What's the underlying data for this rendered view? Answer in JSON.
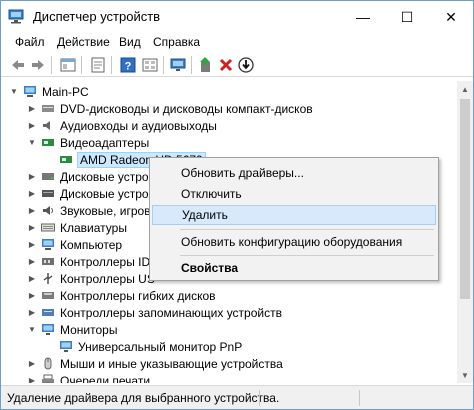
{
  "window": {
    "title": "Диспетчер устройств",
    "minimize_glyph": "—",
    "maximize_glyph": "☐",
    "close_glyph": "✕"
  },
  "menu": {
    "file": "Файл",
    "action": "Действие",
    "view": "Вид",
    "help": "Справка"
  },
  "toolbar": {
    "icons": [
      "back-arrow-icon",
      "forward-arrow-icon",
      "console-tree-icon",
      "properties-icon",
      "help-icon",
      "display-icon",
      "update-driver-icon",
      "uninstall-red-x-icon",
      "scan-hardware-icon"
    ]
  },
  "tree": {
    "root": "Main-PC",
    "items": [
      {
        "label": "DVD-дисководы и дисководы компакт-дисков",
        "expanded": false
      },
      {
        "label": "Аудиовходы и аудиовыходы",
        "expanded": false
      },
      {
        "label": "Видеоадаптеры",
        "expanded": true
      },
      {
        "label": "AMD Radeon HD 5670",
        "child": true,
        "selected": true
      },
      {
        "label": "Дисковые устройства",
        "expanded": false
      },
      {
        "label": "Дисковые устро",
        "expanded": false
      },
      {
        "label": "Звуковые, игрово",
        "expanded": false
      },
      {
        "label": "Клавиатуры",
        "expanded": false
      },
      {
        "label": "Компьютер",
        "expanded": false
      },
      {
        "label": "Контроллеры ID",
        "expanded": false
      },
      {
        "label": "Контроллеры US",
        "expanded": false
      },
      {
        "label": "Контроллеры гибких дисков",
        "expanded": false
      },
      {
        "label": "Контроллеры запоминающих устройств",
        "expanded": false
      },
      {
        "label": "Мониторы",
        "expanded": true
      },
      {
        "label": "Универсальный монитор PnP",
        "child": true
      },
      {
        "label": "Мыши и иные указывающие устройства",
        "expanded": false
      },
      {
        "label": "Очереди печати",
        "expanded": false
      }
    ]
  },
  "context_menu": {
    "update_drivers": "Обновить драйверы...",
    "disable": "Отключить",
    "uninstall": "Удалить",
    "scan_hardware": "Обновить конфигурацию оборудования",
    "properties": "Свойства"
  },
  "status": {
    "text": "Удаление драйвера для выбранного устройства."
  },
  "colors": {
    "accent": "#0078d7",
    "menu_hover": "#d7e9fa",
    "selection": "#cce8ff"
  }
}
